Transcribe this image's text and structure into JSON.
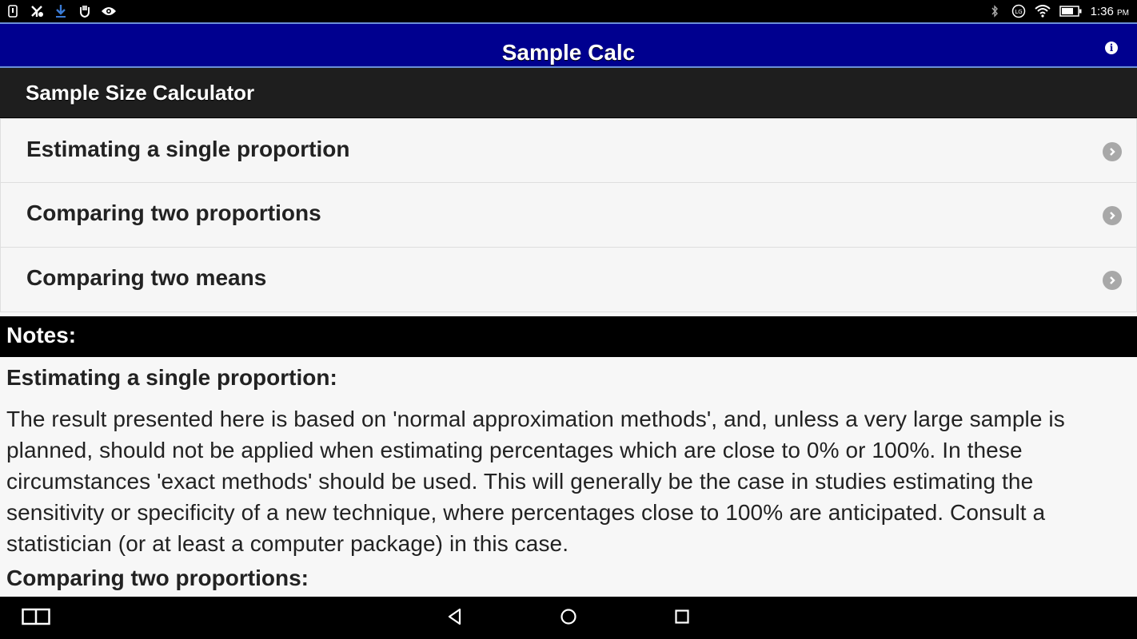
{
  "status_bar": {
    "time": "1:36",
    "ampm": "PM",
    "left_icons": [
      "notification-icon",
      "app-icon",
      "download-icon",
      "vpn-icon",
      "eye-icon"
    ],
    "right_icons": [
      "bluetooth-icon",
      "lte-icon",
      "wifi-icon",
      "battery-icon"
    ]
  },
  "app_bar": {
    "title": "Sample Calc",
    "info_glyph": "i"
  },
  "section_header": {
    "title": "Sample Size Calculator"
  },
  "menu": {
    "items": [
      {
        "label": "Estimating a single proportion"
      },
      {
        "label": "Comparing two proportions"
      },
      {
        "label": "Comparing two means"
      }
    ]
  },
  "notes": {
    "title": "Notes:",
    "sections": [
      {
        "heading": "Estimating a single proportion:",
        "body": "The result presented here is based on 'normal approximation methods', and, unless a very large sample is planned, should not be applied when estimating percentages which are close to 0% or 100%. In these circumstances 'exact methods' should be used. This will generally be the case in studies estimating the sensitivity or specificity of a new technique, where percentages close to 100% are anticipated. Consult a statistician (or at least a computer package) in this case."
      },
      {
        "heading": "Comparing two proportions:"
      }
    ]
  },
  "nav_bar": {
    "buttons": [
      "split-screen-icon",
      "back-icon",
      "home-icon",
      "recents-icon"
    ]
  },
  "colors": {
    "app_bar": "#00008f",
    "section_header": "#1e1e1e",
    "notes_bar": "#000000",
    "list_bg": "#f6f6f6",
    "chevron": "#a8a8a8"
  }
}
